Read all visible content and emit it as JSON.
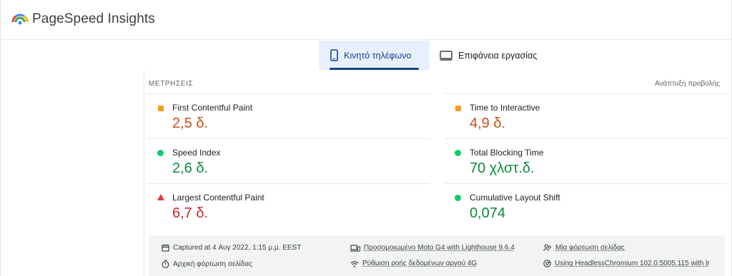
{
  "app": {
    "title": "PageSpeed Insights"
  },
  "tabs": [
    {
      "label": "Κινητό τηλέφωνο",
      "icon": "mobile-phone-icon",
      "active": true
    },
    {
      "label": "Επιφάνεια εργασίας",
      "icon": "desktop-monitor-icon",
      "active": false
    }
  ],
  "metrics_section": {
    "heading": "ΜΕΤΡΗΣΕΙΣ",
    "expand_label": "Ανάπτυξη προβολής",
    "left": [
      {
        "label": "First Contentful Paint",
        "value": "2,5 δ.",
        "status": "average",
        "marker": "orange-square"
      },
      {
        "label": "Speed Index",
        "value": "2,6 δ.",
        "status": "good",
        "marker": "green-circle"
      },
      {
        "label": "Largest Contentful Paint",
        "value": "6,7 δ.",
        "status": "poor",
        "marker": "red-triangle"
      }
    ],
    "right": [
      {
        "label": "Time to Interactive",
        "value": "4,9 δ.",
        "status": "average",
        "marker": "orange-square"
      },
      {
        "label": "Total Blocking Time",
        "value": "70 χλστ.δ.",
        "status": "good",
        "marker": "green-circle"
      },
      {
        "label": "Cumulative Layout Shift",
        "value": "0,074",
        "status": "good",
        "marker": "green-circle"
      }
    ]
  },
  "runtime": {
    "captured": "Captured at 4 Αυγ 2022, 1:15 μ.μ. EEST",
    "initial_load": "Αρχική φόρτωση σελίδας",
    "device": "Προσομοιωμένο Moto G4 with Lighthouse 9.6.4",
    "throttling": "Ρύθμιση ροής δεδομένων αργού 4G",
    "single_load": "Μία φόρτωση σελίδας",
    "browser": "Using HeadlessChromium 102.0.5005.115 with lr"
  },
  "colors": {
    "brand_blue": "#1a3e8a",
    "tab_active_bg": "#e8f0fe",
    "average": "#f4a01c",
    "good": "#0cce6b",
    "poor": "#e53935",
    "runtime_bg": "#f1f3f4"
  }
}
